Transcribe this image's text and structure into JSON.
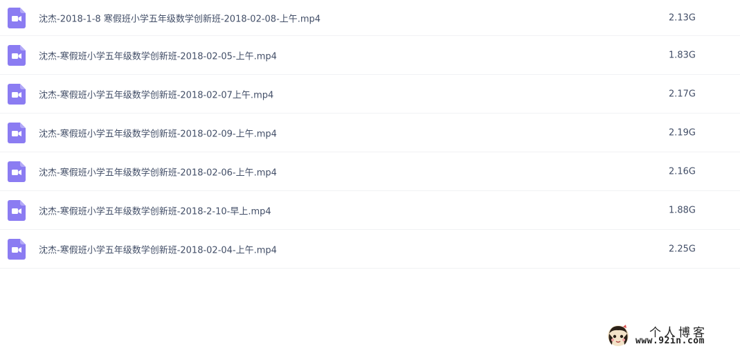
{
  "colors": {
    "icon_fill": "#8b7cf2",
    "text": "#424e67",
    "divider": "#f1f2f4"
  },
  "files": [
    {
      "icon": "video-file-icon",
      "name": "沈杰-2018-1-8 寒假班小学五年级数学创新班-2018-02-08-上午.mp4",
      "size": "2.13G"
    },
    {
      "icon": "video-file-icon",
      "name": "沈杰-寒假班小学五年级数学创新班-2018-02-05-上午.mp4",
      "size": "1.83G"
    },
    {
      "icon": "video-file-icon",
      "name": "沈杰-寒假班小学五年级数学创新班-2018-02-07上午.mp4",
      "size": "2.17G"
    },
    {
      "icon": "video-file-icon",
      "name": "沈杰-寒假班小学五年级数学创新班-2018-02-09-上午.mp4",
      "size": "2.19G"
    },
    {
      "icon": "video-file-icon",
      "name": "沈杰-寒假班小学五年级数学创新班-2018-02-06-上午.mp4",
      "size": "2.16G"
    },
    {
      "icon": "video-file-icon",
      "name": "沈杰-寒假班小学五年级数学创新班-2018-2-10-早上.mp4",
      "size": "1.88G"
    },
    {
      "icon": "video-file-icon",
      "name": "沈杰-寒假班小学五年级数学创新班-2018-02-04-上午.mp4",
      "size": "2.25G"
    }
  ],
  "watermark": {
    "title": "个人博客",
    "url": "www.92in.com"
  }
}
